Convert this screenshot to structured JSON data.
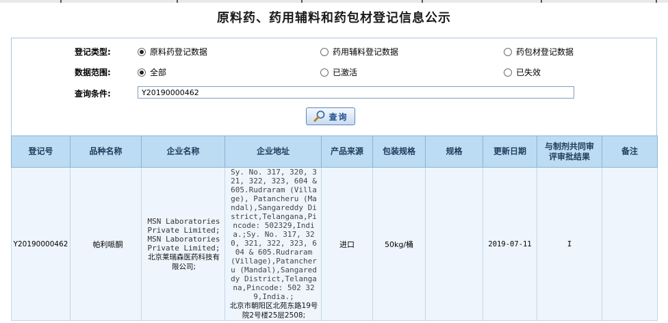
{
  "page": {
    "title": "原料药、药用辅料和药包材登记信息公示"
  },
  "form": {
    "registration_type": {
      "label": "登记类型:",
      "options": [
        "原料药登记数据",
        "药用辅料登记数据",
        "药包材登记数据"
      ],
      "selected": "原料药登记数据"
    },
    "data_range": {
      "label": "数据范围:",
      "options": [
        "全部",
        "已激活",
        "已失效"
      ],
      "selected": "全部"
    },
    "query": {
      "label": "查询条件:",
      "value": "Y20190000462"
    },
    "search_button": {
      "label": "查询",
      "icon": "magnifier-icon"
    }
  },
  "table": {
    "headers": [
      "登记号",
      "品种名称",
      "企业名称",
      "企业地址",
      "产品来源",
      "包装规格",
      "规格",
      "更新日期",
      "与制剂共同审评审批结果",
      "备注"
    ],
    "rows": [
      {
        "reg_no": "Y20190000462",
        "product_name": "帕利哌酮",
        "company_en": "MSN Laboratories Private Limited;MSN Laboratories Private Limited;",
        "company_cn": "北京莱瑞森医药科技有限公司;",
        "address_en": "Sy. No. 317, 320, 321, 322, 323, 604 & 605.Rudraram (Village), Patancheru (Mandal),Sangareddy District,Telangana,Pincode: 502329,India.;Sy. No. 317, 320, 321, 322, 323, 604 & 605.Rudraram (Village),Patancheru (Mandal),Sangareddy District,Telangana,Pincode: 502 329,India.;",
        "address_cn": "北京市朝阳区北苑东路19号院2号楼25层2508;",
        "source": "进口",
        "package": "50kg/桶",
        "spec": "",
        "update_date": "2019-07-11",
        "review_result": "I",
        "remark": ""
      }
    ]
  },
  "colors": {
    "header_bg": "#bcdcf4",
    "row_bg": "#eef5fc",
    "border": "#8fb2d0"
  }
}
